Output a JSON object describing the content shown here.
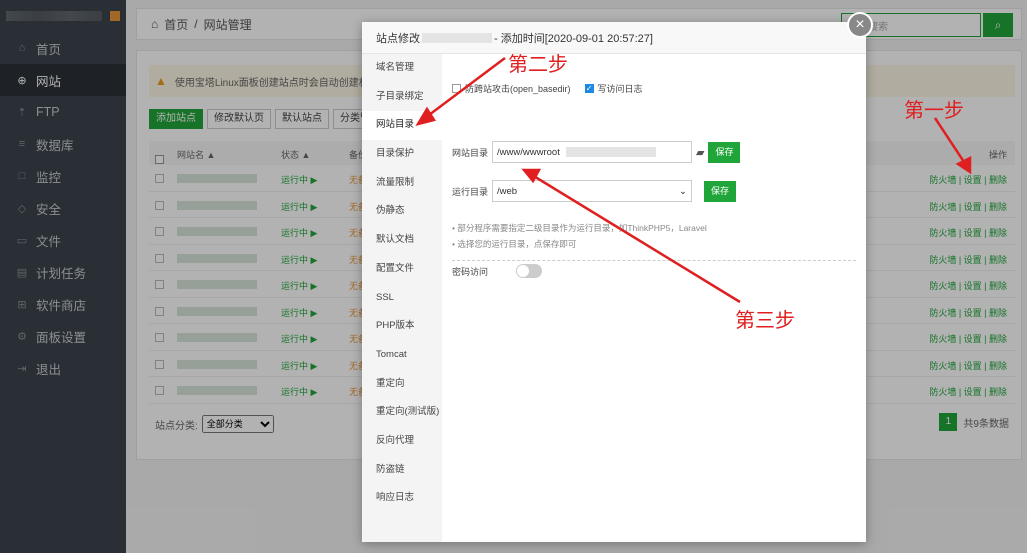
{
  "sidebar": {
    "items": [
      {
        "label": "首页",
        "icon": "home-icon",
        "glyph": "⌂"
      },
      {
        "label": "网站",
        "icon": "globe-icon",
        "glyph": "⊕"
      },
      {
        "label": "FTP",
        "icon": "ftp-icon",
        "glyph": "⇡"
      },
      {
        "label": "数据库",
        "icon": "database-icon",
        "glyph": "≡"
      },
      {
        "label": "监控",
        "icon": "monitor-icon",
        "glyph": "□"
      },
      {
        "label": "安全",
        "icon": "shield-icon",
        "glyph": "◇"
      },
      {
        "label": "文件",
        "icon": "folder-icon",
        "glyph": "▭"
      },
      {
        "label": "计划任务",
        "icon": "calendar-icon",
        "glyph": "▤"
      },
      {
        "label": "软件商店",
        "icon": "grid-icon",
        "glyph": "⊞"
      },
      {
        "label": "面板设置",
        "icon": "gear-icon",
        "glyph": "⚙"
      },
      {
        "label": "退出",
        "icon": "logout-icon",
        "glyph": "⇥"
      }
    ]
  },
  "breadcrumb": {
    "home": "首页",
    "sep": "/",
    "current": "网站管理"
  },
  "search": {
    "placeholder": "网站搜索"
  },
  "warning": "使用宝塔Linux面板创建站点时会自动创建权限配置",
  "toolbar": {
    "add": "添加站点",
    "edit_default": "修改默认页",
    "default_site": "默认站点",
    "category": "分类管理"
  },
  "table": {
    "headers": {
      "name": "网站名 ▲",
      "status": "状态 ▲",
      "backup": "备份",
      "ops": "操作"
    },
    "rows": [
      {
        "status": "运行中 ▶",
        "backup": "无备",
        "ops": "防火墙 | 设置 | 删除"
      },
      {
        "status": "运行中 ▶",
        "backup": "无备",
        "ops": "防火墙 | 设置 | 删除"
      },
      {
        "status": "运行中 ▶",
        "backup": "无备",
        "ops": "防火墙 | 设置 | 删除"
      },
      {
        "status": "运行中 ▶",
        "backup": "无备",
        "ops": "防火墙 | 设置 | 删除"
      },
      {
        "status": "运行中 ▶",
        "backup": "无备",
        "ops": "防火墙 | 设置 | 删除"
      },
      {
        "status": "运行中 ▶",
        "backup": "无备",
        "ops": "防火墙 | 设置 | 删除"
      },
      {
        "status": "运行中 ▶",
        "backup": "无备",
        "ops": "防火墙 | 设置 | 删除"
      },
      {
        "status": "运行中 ▶",
        "backup": "无备",
        "ops": "防火墙 | 设置 | 删除"
      },
      {
        "status": "运行中 ▶",
        "backup": "无备",
        "ops": "防火墙 | 设置 | 删除"
      }
    ]
  },
  "footer": {
    "category_label": "站点分类:",
    "category_value": "全部分类",
    "page": "1",
    "total": "共9条数据"
  },
  "modal": {
    "title_prefix": "站点修改",
    "title_suffix": "- 添加时间[2020-09-01 20:57:27]",
    "close": "×",
    "menu": [
      "域名管理",
      "子目录绑定",
      "网站目录",
      "目录保护",
      "流量限制",
      "伪静态",
      "默认文档",
      "配置文件",
      "SSL",
      "PHP版本",
      "Tomcat",
      "重定向",
      "重定向(测试版)",
      "反向代理",
      "防盗链",
      "响应日志"
    ],
    "active_index": 2,
    "anti_xss": "防跨站攻击(open_basedir)",
    "access_log": "写访问日志",
    "site_dir_label": "网站目录",
    "site_dir_value": "/www/wwwroot",
    "save": "保存",
    "run_dir_label": "运行目录",
    "run_dir_value": "/web",
    "tips": [
      "部分程序需要指定二级目录作为运行目录，如ThinkPHP5，Laravel",
      "选择您的运行目录，点保存即可"
    ],
    "password_access": "密码访问"
  },
  "annotations": {
    "step1": "第一步",
    "step2": "第二步",
    "step3": "第三步"
  },
  "colors": {
    "accent": "#20a53a",
    "sidebar": "#3c444d",
    "annotation": "#e02020"
  }
}
